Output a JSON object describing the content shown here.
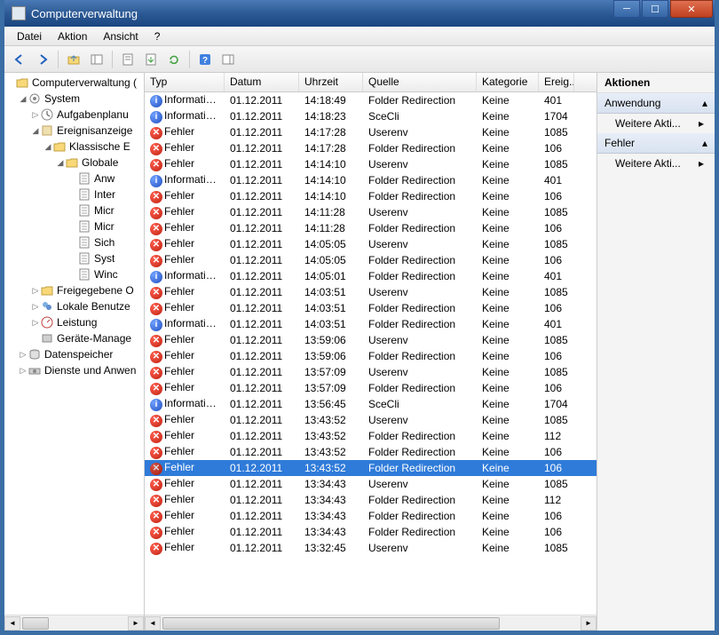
{
  "window": {
    "title": "Computerverwaltung"
  },
  "menu": {
    "file": "Datei",
    "action": "Aktion",
    "view": "Ansicht",
    "help": "?"
  },
  "tree": {
    "root": "Computerverwaltung (",
    "system": "System",
    "aufgaben": "Aufgabenplanu",
    "ereignis": "Ereignisanzeige",
    "klassische": "Klassische E",
    "globale": "Globale",
    "anw": "Anw",
    "inter": "Inter",
    "micr1": "Micr",
    "micr2": "Micr",
    "sich": "Sich",
    "syst": "Syst",
    "wind": "Winc",
    "freigegebene": "Freigegebene O",
    "lokale": "Lokale Benutze",
    "leistung": "Leistung",
    "geraete": "Geräte-Manage",
    "datenspeicher": "Datenspeicher",
    "dienste": "Dienste und Anwen"
  },
  "columns": {
    "typ": "Typ",
    "datum": "Datum",
    "uhrzeit": "Uhrzeit",
    "quelle": "Quelle",
    "kategorie": "Kategorie",
    "ereig": "Ereig..."
  },
  "col_widths": {
    "typ": 90,
    "datum": 84,
    "uhrzeit": 72,
    "quelle": 128,
    "kategorie": 70,
    "ereig": 40
  },
  "events": [
    {
      "type": "info",
      "typ": "Informatio...",
      "datum": "01.12.2011",
      "uhrzeit": "14:18:49",
      "quelle": "Folder Redirection",
      "kat": "Keine",
      "id": "401"
    },
    {
      "type": "info",
      "typ": "Informatio...",
      "datum": "01.12.2011",
      "uhrzeit": "14:18:23",
      "quelle": "SceCli",
      "kat": "Keine",
      "id": "1704"
    },
    {
      "type": "error",
      "typ": "Fehler",
      "datum": "01.12.2011",
      "uhrzeit": "14:17:28",
      "quelle": "Userenv",
      "kat": "Keine",
      "id": "1085"
    },
    {
      "type": "error",
      "typ": "Fehler",
      "datum": "01.12.2011",
      "uhrzeit": "14:17:28",
      "quelle": "Folder Redirection",
      "kat": "Keine",
      "id": "106"
    },
    {
      "type": "error",
      "typ": "Fehler",
      "datum": "01.12.2011",
      "uhrzeit": "14:14:10",
      "quelle": "Userenv",
      "kat": "Keine",
      "id": "1085"
    },
    {
      "type": "info",
      "typ": "Informatio...",
      "datum": "01.12.2011",
      "uhrzeit": "14:14:10",
      "quelle": "Folder Redirection",
      "kat": "Keine",
      "id": "401"
    },
    {
      "type": "error",
      "typ": "Fehler",
      "datum": "01.12.2011",
      "uhrzeit": "14:14:10",
      "quelle": "Folder Redirection",
      "kat": "Keine",
      "id": "106"
    },
    {
      "type": "error",
      "typ": "Fehler",
      "datum": "01.12.2011",
      "uhrzeit": "14:11:28",
      "quelle": "Userenv",
      "kat": "Keine",
      "id": "1085"
    },
    {
      "type": "error",
      "typ": "Fehler",
      "datum": "01.12.2011",
      "uhrzeit": "14:11:28",
      "quelle": "Folder Redirection",
      "kat": "Keine",
      "id": "106"
    },
    {
      "type": "error",
      "typ": "Fehler",
      "datum": "01.12.2011",
      "uhrzeit": "14:05:05",
      "quelle": "Userenv",
      "kat": "Keine",
      "id": "1085"
    },
    {
      "type": "error",
      "typ": "Fehler",
      "datum": "01.12.2011",
      "uhrzeit": "14:05:05",
      "quelle": "Folder Redirection",
      "kat": "Keine",
      "id": "106"
    },
    {
      "type": "info",
      "typ": "Informatio...",
      "datum": "01.12.2011",
      "uhrzeit": "14:05:01",
      "quelle": "Folder Redirection",
      "kat": "Keine",
      "id": "401"
    },
    {
      "type": "error",
      "typ": "Fehler",
      "datum": "01.12.2011",
      "uhrzeit": "14:03:51",
      "quelle": "Userenv",
      "kat": "Keine",
      "id": "1085"
    },
    {
      "type": "error",
      "typ": "Fehler",
      "datum": "01.12.2011",
      "uhrzeit": "14:03:51",
      "quelle": "Folder Redirection",
      "kat": "Keine",
      "id": "106"
    },
    {
      "type": "info",
      "typ": "Informatio...",
      "datum": "01.12.2011",
      "uhrzeit": "14:03:51",
      "quelle": "Folder Redirection",
      "kat": "Keine",
      "id": "401"
    },
    {
      "type": "error",
      "typ": "Fehler",
      "datum": "01.12.2011",
      "uhrzeit": "13:59:06",
      "quelle": "Userenv",
      "kat": "Keine",
      "id": "1085"
    },
    {
      "type": "error",
      "typ": "Fehler",
      "datum": "01.12.2011",
      "uhrzeit": "13:59:06",
      "quelle": "Folder Redirection",
      "kat": "Keine",
      "id": "106"
    },
    {
      "type": "error",
      "typ": "Fehler",
      "datum": "01.12.2011",
      "uhrzeit": "13:57:09",
      "quelle": "Userenv",
      "kat": "Keine",
      "id": "1085"
    },
    {
      "type": "error",
      "typ": "Fehler",
      "datum": "01.12.2011",
      "uhrzeit": "13:57:09",
      "quelle": "Folder Redirection",
      "kat": "Keine",
      "id": "106"
    },
    {
      "type": "info",
      "typ": "Informatio...",
      "datum": "01.12.2011",
      "uhrzeit": "13:56:45",
      "quelle": "SceCli",
      "kat": "Keine",
      "id": "1704"
    },
    {
      "type": "error",
      "typ": "Fehler",
      "datum": "01.12.2011",
      "uhrzeit": "13:43:52",
      "quelle": "Userenv",
      "kat": "Keine",
      "id": "1085"
    },
    {
      "type": "error",
      "typ": "Fehler",
      "datum": "01.12.2011",
      "uhrzeit": "13:43:52",
      "quelle": "Folder Redirection",
      "kat": "Keine",
      "id": "112"
    },
    {
      "type": "error",
      "typ": "Fehler",
      "datum": "01.12.2011",
      "uhrzeit": "13:43:52",
      "quelle": "Folder Redirection",
      "kat": "Keine",
      "id": "106"
    },
    {
      "type": "error",
      "typ": "Fehler",
      "datum": "01.12.2011",
      "uhrzeit": "13:43:52",
      "quelle": "Folder Redirection",
      "kat": "Keine",
      "id": "106",
      "selected": true
    },
    {
      "type": "error",
      "typ": "Fehler",
      "datum": "01.12.2011",
      "uhrzeit": "13:34:43",
      "quelle": "Userenv",
      "kat": "Keine",
      "id": "1085"
    },
    {
      "type": "error",
      "typ": "Fehler",
      "datum": "01.12.2011",
      "uhrzeit": "13:34:43",
      "quelle": "Folder Redirection",
      "kat": "Keine",
      "id": "112"
    },
    {
      "type": "error",
      "typ": "Fehler",
      "datum": "01.12.2011",
      "uhrzeit": "13:34:43",
      "quelle": "Folder Redirection",
      "kat": "Keine",
      "id": "106"
    },
    {
      "type": "error",
      "typ": "Fehler",
      "datum": "01.12.2011",
      "uhrzeit": "13:34:43",
      "quelle": "Folder Redirection",
      "kat": "Keine",
      "id": "106"
    },
    {
      "type": "error",
      "typ": "Fehler",
      "datum": "01.12.2011",
      "uhrzeit": "13:32:45",
      "quelle": "Userenv",
      "kat": "Keine",
      "id": "1085"
    }
  ],
  "actions": {
    "title": "Aktionen",
    "section1": "Anwendung",
    "link1": "Weitere Akti...",
    "section2": "Fehler",
    "link2": "Weitere Akti..."
  }
}
